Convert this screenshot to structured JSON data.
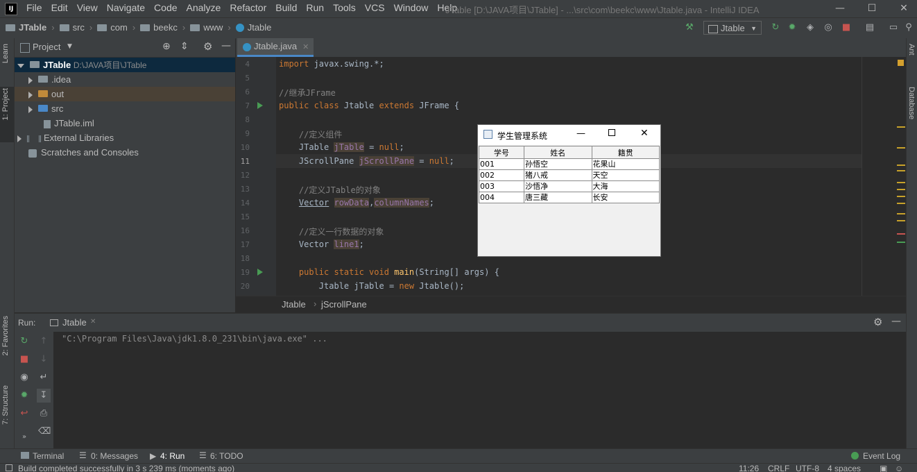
{
  "menubar": {
    "logo": "IJ",
    "items": [
      "File",
      "Edit",
      "View",
      "Navigate",
      "Code",
      "Analyze",
      "Refactor",
      "Build",
      "Run",
      "Tools",
      "VCS",
      "Window",
      "Help"
    ],
    "window_title": "JTable [D:\\JAVA项目\\JTable] - ...\\src\\com\\beekc\\www\\Jtable.java - IntelliJ IDEA"
  },
  "navbar": {
    "crumbs": [
      "JTable",
      "src",
      "com",
      "beekc",
      "www",
      "Jtable"
    ],
    "run_config": "Jtable"
  },
  "left_stripe": {
    "learn": "Learn",
    "project": "1: Project",
    "favorites": "2: Favorites",
    "structure": "7: Structure"
  },
  "right_stripe": {
    "ant": "Ant",
    "database": "Database"
  },
  "project_panel": {
    "title": "Project",
    "tree": [
      {
        "label": "JTable",
        "path": "D:\\JAVA项目\\JTable"
      },
      {
        "label": ".idea"
      },
      {
        "label": "out"
      },
      {
        "label": "src"
      },
      {
        "label": "JTable.iml"
      },
      {
        "label": "External Libraries"
      },
      {
        "label": "Scratches and Consoles"
      }
    ]
  },
  "editor": {
    "tab_label": "Jtable.java",
    "line_numbers": [
      "4",
      "5",
      "6",
      "7",
      "8",
      "9",
      "10",
      "11",
      "12",
      "13",
      "14",
      "15",
      "16",
      "17",
      "18",
      "19",
      "20"
    ],
    "breadcrumb": [
      "Jtable",
      "jScrollPane"
    ]
  },
  "swing_window": {
    "title": "学生管理系统",
    "columns": [
      "学号",
      "姓名",
      "籍贯"
    ],
    "rows": [
      [
        "001",
        "孙悟空",
        "花果山"
      ],
      [
        "002",
        "猪八戒",
        "天空"
      ],
      [
        "003",
        "沙悟净",
        "大海"
      ],
      [
        "004",
        "唐三藏",
        "长安"
      ]
    ]
  },
  "run_panel": {
    "label": "Run:",
    "tab": "Jtable",
    "console_text": "\"C:\\Program Files\\Java\\jdk1.8.0_231\\bin\\java.exe\" ..."
  },
  "bottom_tabs": {
    "terminal": "Terminal",
    "messages": "0: Messages",
    "run": "4: Run",
    "todo": "6: TODO",
    "event_log": "Event Log"
  },
  "status": {
    "message": "Build completed successfully in 3 s 239 ms (moments ago)",
    "position": "11:26",
    "line_sep": "CRLF",
    "encoding": "UTF-8",
    "indent": "4 spaces"
  },
  "colors": {
    "keyword": "#cc7832",
    "comment": "#808080",
    "field": "#9876aa",
    "method": "#ffc66d",
    "accent": "#4a88c7"
  }
}
